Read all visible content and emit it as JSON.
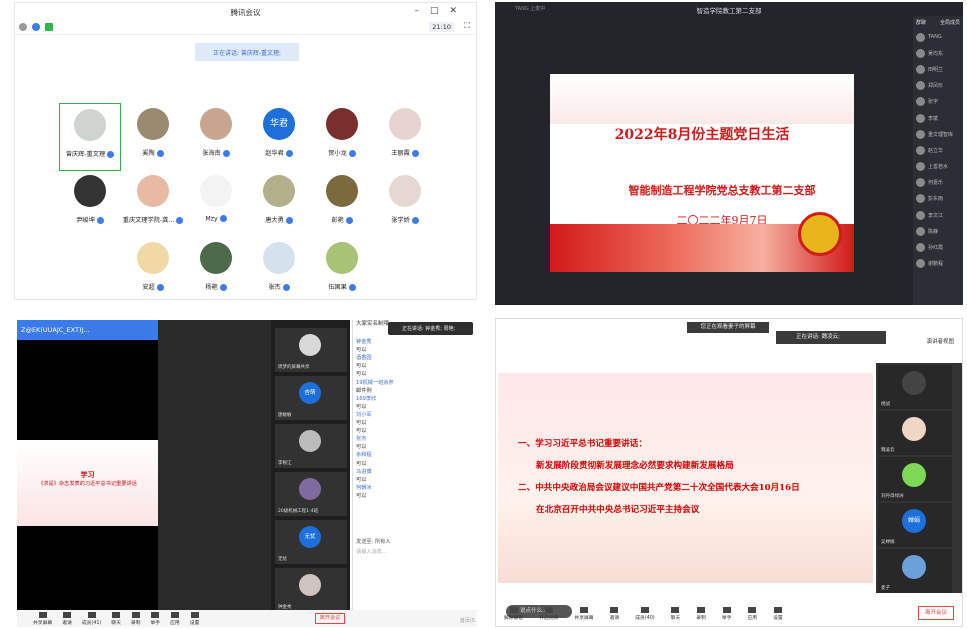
{
  "p1": {
    "title": "腾讯会议",
    "timer": "21:10",
    "speaking": "正在讲话: 曾庆辉-重文理;",
    "tiles": [
      {
        "name": "曾庆辉-重文理",
        "color": "#cfd4d0"
      },
      {
        "name": "奚陶",
        "color": "#9a8a70"
      },
      {
        "name": "张海南",
        "color": "#c7a58f"
      },
      {
        "name": "赵华君",
        "color": "#1d6fd9",
        "text": "华君"
      },
      {
        "name": "贺小龙",
        "color": "#7a2f2f"
      },
      {
        "name": "王丽霞",
        "color": "#e7d3cf"
      },
      {
        "name": "尹峻坤",
        "color": "#333333"
      },
      {
        "name": "重庆文理学院-龚...",
        "color": "#e8b9a3"
      },
      {
        "name": "Mzy",
        "color": "#f3f3f3"
      },
      {
        "name": "唐大勇",
        "color": "#b3b08c"
      },
      {
        "name": "彭艳",
        "color": "#7c6a3f"
      },
      {
        "name": "张学娇",
        "color": "#e5d8d2"
      },
      {
        "name": "安超",
        "color": "#f1d9a6"
      },
      {
        "name": "杨艳",
        "color": "#4d6a4b"
      },
      {
        "name": "张杰",
        "color": "#d4e2ee"
      },
      {
        "name": "伍国果",
        "color": "#a8c276"
      }
    ]
  },
  "p2": {
    "title": "智造学院教工第二支部",
    "sub": "TANG  上麦中",
    "side_head": "群聊",
    "side_mode": "全局成员",
    "slide_title": "2022年8月份主题党日生活",
    "slide_line1": "智能制造工程学院党总支教工第二支部",
    "slide_line2": "二〇二二年9月7日",
    "members": [
      "TANG",
      "吴均东",
      "田明兰",
      "郑凤珍",
      "张宇",
      "李斌",
      "重文理智库",
      "赵立华",
      "上善若水",
      "何嘉乐",
      "彭东雨",
      "李文江",
      "陈静",
      "孙红霞",
      "谢鹏程"
    ]
  },
  "p3": {
    "phone_title": "Z@EK(UUAJC_EXT)J...",
    "tip": "正在讲话: 钟金秀; 周艳;",
    "chat_head": "大家实名制哦",
    "slide_title": "学习",
    "slide_text": "《求是》杂志发表的习近平总书记重要讲话",
    "chat": [
      {
        "t": "钟金秀",
        "n": true
      },
      {
        "t": "可以",
        "n": false
      },
      {
        "t": "酒香园",
        "n": true
      },
      {
        "t": "可以",
        "n": false
      },
      {
        "t": "可以",
        "n": false
      },
      {
        "t": "19机械一班余彦",
        "n": true
      },
      {
        "t": "邮件例",
        "n": false
      },
      {
        "t": "169李欣",
        "n": true
      },
      {
        "t": "可以",
        "n": false
      },
      {
        "t": "刘小军",
        "n": true
      },
      {
        "t": "可以",
        "n": false
      },
      {
        "t": "可以",
        "n": false
      },
      {
        "t": "张杰",
        "n": true
      },
      {
        "t": "可以",
        "n": false
      },
      {
        "t": "余和程",
        "n": true
      },
      {
        "t": "可以",
        "n": false
      },
      {
        "t": "马进博",
        "n": true
      },
      {
        "t": "可以",
        "n": false
      },
      {
        "t": "何朝冰",
        "n": true
      },
      {
        "t": "可以",
        "n": false
      }
    ],
    "send_to": "发送至: 所有人",
    "placeholder": "请输入消息...",
    "thumbs": [
      {
        "name": "周梦的屏幕共享",
        "color": "#d8d8d8"
      },
      {
        "name": "唐敏敏",
        "color": "#1d6fd9",
        "text": "杏萌"
      },
      {
        "name": "李根江",
        "color": "#bcbcbc"
      },
      {
        "name": "20级机械工程1-4班",
        "color": "#7f6b9d"
      },
      {
        "name": "无忧",
        "color": "#1d6fd9",
        "text": "无忧"
      },
      {
        "name": "钟金秀",
        "color": "#cfc4bd"
      }
    ],
    "bottom": [
      "共享屏幕",
      "邀请",
      "成员(41)",
      "聊天",
      "录制",
      "举手",
      "应用",
      "设置"
    ],
    "leave": "离开会议",
    "page": "首页(5"
  },
  "p4": {
    "watching": "您正在观看妻子的屏幕",
    "speaking": "正在讲话: 魏凌云;",
    "view": "演讲者视图",
    "line1": "一、学习习近平总书记重要讲话：",
    "line2": "新发展阶段贯彻新发展理念必然要求构建新发展格局",
    "line3": "二、中共中央政治局会议建议中国共产党第二十次全国代表大会10月16日",
    "line4": "在北京召开中共中央总书记习近平主持会议",
    "comment": "说点什么...",
    "right": [
      {
        "name": "杨战",
        "color": "#444"
      },
      {
        "name": "魏凌云",
        "color": "#f0d6c4"
      },
      {
        "name": "刘丹母绿洲",
        "color": "#7ed957"
      },
      {
        "name": "吴婵娟",
        "color": "#1d6fd9",
        "text": "婵娟"
      },
      {
        "name": "麦子",
        "color": "#6aa1d8"
      }
    ],
    "bottom": [
      "解除静音",
      "开启视频",
      "共享屏幕",
      "邀请",
      "成员(40)",
      "聊天",
      "录制",
      "举手",
      "应用",
      "设置"
    ],
    "leave": "离开会议"
  }
}
